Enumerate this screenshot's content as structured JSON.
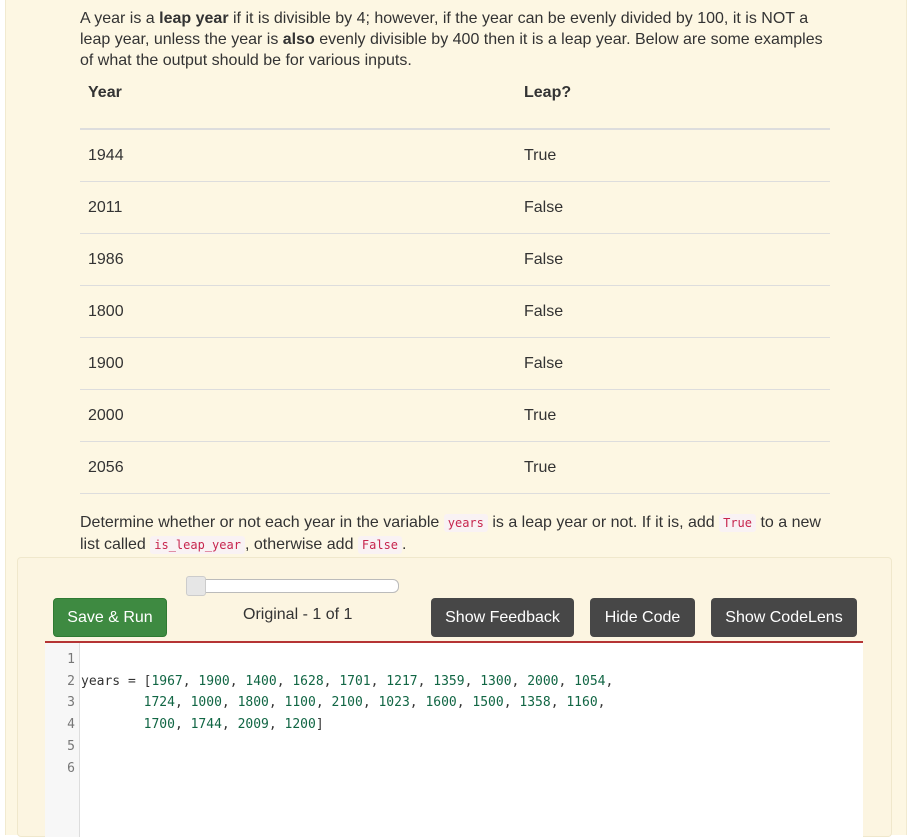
{
  "intro": {
    "p1": "A year is a ",
    "b1": "leap year",
    "p2": " if it is divisible by 4; however, if the year can be evenly divided by 100, it is NOT a leap year, unless the year is ",
    "b2": "also",
    "p3": " evenly divisible by 400 then it is a leap year. Below are some examples of what the output should be for various inputs."
  },
  "table": {
    "headers": [
      "Year",
      "Leap?"
    ],
    "rows": [
      [
        "1944",
        "True"
      ],
      [
        "2011",
        "False"
      ],
      [
        "1986",
        "False"
      ],
      [
        "1800",
        "False"
      ],
      [
        "1900",
        "False"
      ],
      [
        "2000",
        "True"
      ],
      [
        "2056",
        "True"
      ]
    ]
  },
  "task": {
    "t1": "Determine whether or not each year in the variable ",
    "c1": "years",
    "t2": " is a leap year or not. If it is, add ",
    "c2": "True",
    "t3": " to a new list called ",
    "c3": "is_leap_year",
    "t4": ", otherwise add ",
    "c4": "False",
    "t5": "."
  },
  "toolbar": {
    "save_run": "Save & Run",
    "version": "Original - 1 of 1",
    "feedback": "Show Feedback",
    "hide_code": "Hide Code",
    "codelens": "Show CodeLens",
    "slider_value": 0
  },
  "editor": {
    "line_numbers": [
      "1",
      "2",
      "3",
      "4",
      "5",
      "6"
    ],
    "lines": [
      "",
      "years = [1967, 1900, 1400, 1628, 1701, 1217, 1359, 1300, 2000, 1054,",
      "        1724, 1000, 1800, 1100, 2100, 1023, 1600, 1500, 1358, 1160,",
      "        1700, 1744, 2009, 1200]",
      "",
      ""
    ]
  }
}
